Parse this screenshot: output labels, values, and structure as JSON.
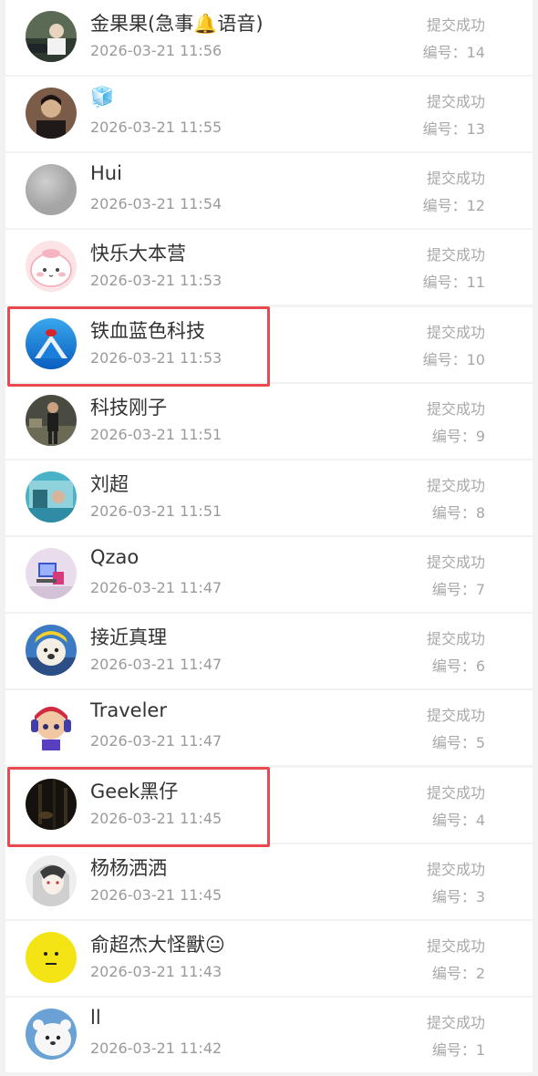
{
  "submissions": [
    {
      "name": "金果果(急事🔔语音)",
      "time": "2026-03-21 11:56",
      "status": "提交成功",
      "number": "编号：14",
      "avatar": "avatar-man-car"
    },
    {
      "name": "🧊",
      "time": "2026-03-21 11:55",
      "status": "提交成功",
      "number": "编号：13",
      "avatar": "avatar-man-portrait"
    },
    {
      "name": "Hui",
      "time": "2026-03-21 11:54",
      "status": "提交成功",
      "number": "编号：12",
      "avatar": "avatar-gray"
    },
    {
      "name": "快乐大本营",
      "time": "2026-03-21 11:53",
      "status": "提交成功",
      "number": "编号：11",
      "avatar": "avatar-pink-cartoon"
    },
    {
      "name": "铁血蓝色科技",
      "time": "2026-03-21 11:53",
      "status": "提交成功",
      "number": "编号：10",
      "avatar": "avatar-blue-logo"
    },
    {
      "name": "科技刚子",
      "time": "2026-03-21 11:51",
      "status": "提交成功",
      "number": "编号：9",
      "avatar": "avatar-man-standing"
    },
    {
      "name": "刘超",
      "time": "2026-03-21 11:51",
      "status": "提交成功",
      "number": "编号：8",
      "avatar": "avatar-cyan-scene"
    },
    {
      "name": "Qzao",
      "time": "2026-03-21 11:47",
      "status": "提交成功",
      "number": "编号：7",
      "avatar": "avatar-computer"
    },
    {
      "name": "接近真理",
      "time": "2026-03-21 11:47",
      "status": "提交成功",
      "number": "编号：6",
      "avatar": "avatar-yellow-dog"
    },
    {
      "name": "Traveler",
      "time": "2026-03-21 11:47",
      "status": "提交成功",
      "number": "编号：5",
      "avatar": "avatar-cartoon-headphones"
    },
    {
      "name": "Geek黑仔",
      "time": "2026-03-21 11:45",
      "status": "提交成功",
      "number": "编号：4",
      "avatar": "avatar-dark-forest"
    },
    {
      "name": "杨杨洒洒",
      "time": "2026-03-21 11:45",
      "status": "提交成功",
      "number": "编号：3",
      "avatar": "avatar-anime-girl"
    },
    {
      "name": "俞超杰大怪獸😐",
      "time": "2026-03-21 11:43",
      "status": "提交成功",
      "number": "编号：2",
      "avatar": "avatar-yellow-face"
    },
    {
      "name": "ll",
      "time": "2026-03-21 11:42",
      "status": "提交成功",
      "number": "编号：1",
      "avatar": "avatar-white-bear"
    }
  ],
  "colors": {
    "highlight_border": "#e94a4f",
    "name_text": "#333333",
    "meta_text": "#9a9a9a"
  }
}
